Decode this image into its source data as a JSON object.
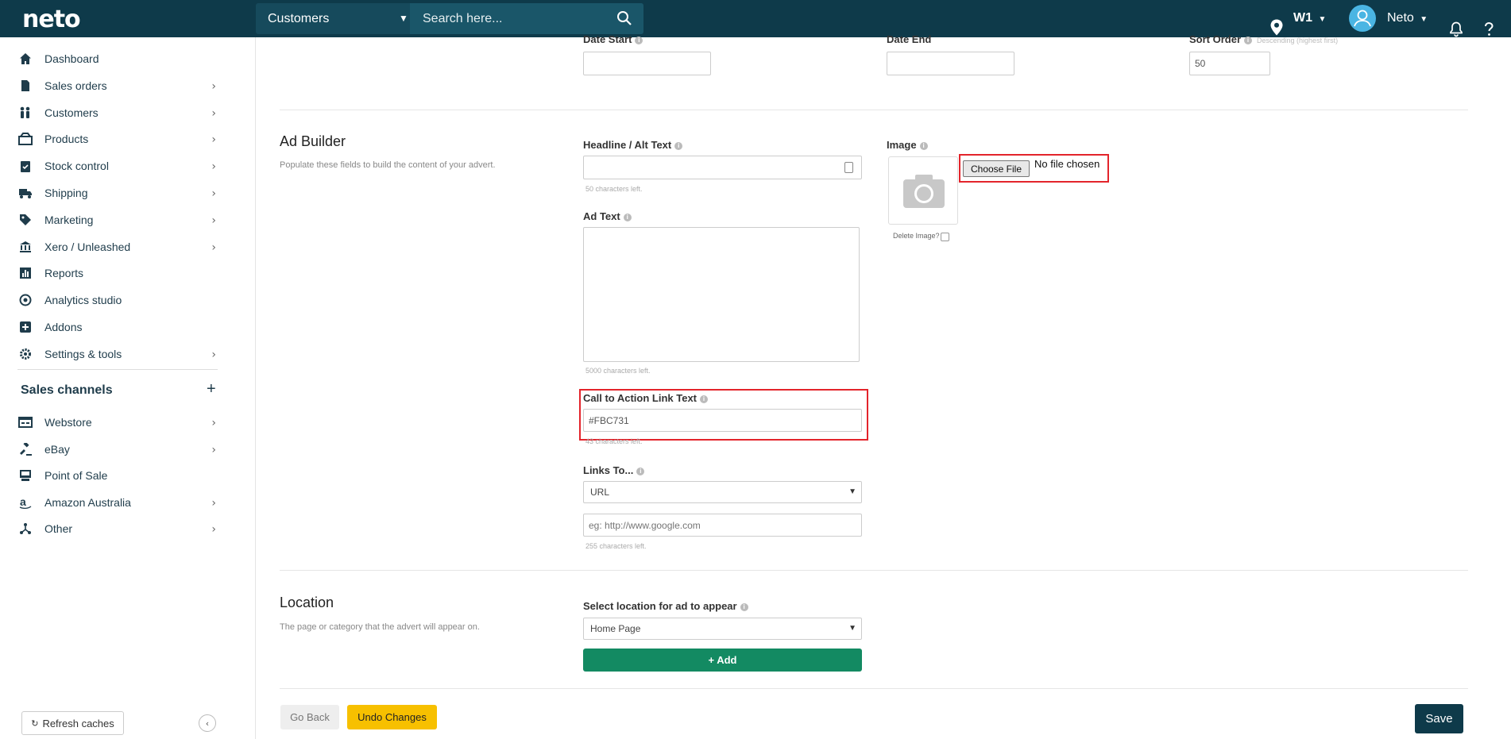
{
  "header": {
    "logo": "neto",
    "search_scope": "Customers",
    "search_placeholder": "Search here...",
    "store": "W1",
    "user": "Neto"
  },
  "sidebar": {
    "items": [
      {
        "label": "Dashboard",
        "icon": "home-icon",
        "chevron": false
      },
      {
        "label": "Sales orders",
        "icon": "document-icon",
        "chevron": true
      },
      {
        "label": "Customers",
        "icon": "users-icon",
        "chevron": true
      },
      {
        "label": "Products",
        "icon": "box-icon",
        "chevron": true
      },
      {
        "label": "Stock control",
        "icon": "clipboard-check-icon",
        "chevron": true
      },
      {
        "label": "Shipping",
        "icon": "truck-icon",
        "chevron": true
      },
      {
        "label": "Marketing",
        "icon": "tag-icon",
        "chevron": true
      },
      {
        "label": "Xero / Unleashed",
        "icon": "bank-icon",
        "chevron": true
      },
      {
        "label": "Reports",
        "icon": "bar-chart-icon",
        "chevron": false
      },
      {
        "label": "Analytics studio",
        "icon": "analytics-icon",
        "chevron": false
      },
      {
        "label": "Addons",
        "icon": "plus-square-icon",
        "chevron": false
      },
      {
        "label": "Settings & tools",
        "icon": "gear-icon",
        "chevron": true
      }
    ],
    "sales_channels_title": "Sales channels",
    "channels": [
      {
        "label": "Webstore",
        "icon": "webstore-icon",
        "chevron": true
      },
      {
        "label": "eBay",
        "icon": "gavel-icon",
        "chevron": true
      },
      {
        "label": "Point of Sale",
        "icon": "pos-icon",
        "chevron": false
      },
      {
        "label": "Amazon Australia",
        "icon": "amazon-icon",
        "chevron": true
      },
      {
        "label": "Other",
        "icon": "network-icon",
        "chevron": true
      }
    ],
    "refresh_label": "Refresh caches"
  },
  "top_fields": {
    "date_start_label": "Date Start",
    "date_start_value": "",
    "date_end_label": "Date End",
    "date_end_value": "",
    "sort_order_label": "Sort Order",
    "sort_order_hint": "Descending (highest first)",
    "sort_order_value": "50"
  },
  "ad_builder": {
    "title": "Ad Builder",
    "description": "Populate these fields to build the content of your advert.",
    "headline_label": "Headline / Alt Text",
    "headline_value": "",
    "headline_hint": "50 characters left.",
    "ad_text_label": "Ad Text",
    "ad_text_value": "",
    "ad_text_hint": "5000 characters left.",
    "cta_label": "Call to Action Link Text",
    "cta_value": "#FBC731",
    "cta_hint": "43 characters left.",
    "links_to_label": "Links To...",
    "links_to_value": "URL",
    "url_placeholder": "eg: http://www.google.com",
    "url_hint": "255 characters left.",
    "image_label": "Image",
    "choose_file_label": "Choose File",
    "no_file_text": "No file chosen",
    "delete_image_label": "Delete Image?"
  },
  "location": {
    "title": "Location",
    "description": "The page or category that the advert will appear on.",
    "select_label": "Select location for ad to appear",
    "select_value": "Home Page",
    "add_label": "+ Add"
  },
  "footer": {
    "go_back": "Go Back",
    "undo": "Undo Changes",
    "save": "Save"
  }
}
